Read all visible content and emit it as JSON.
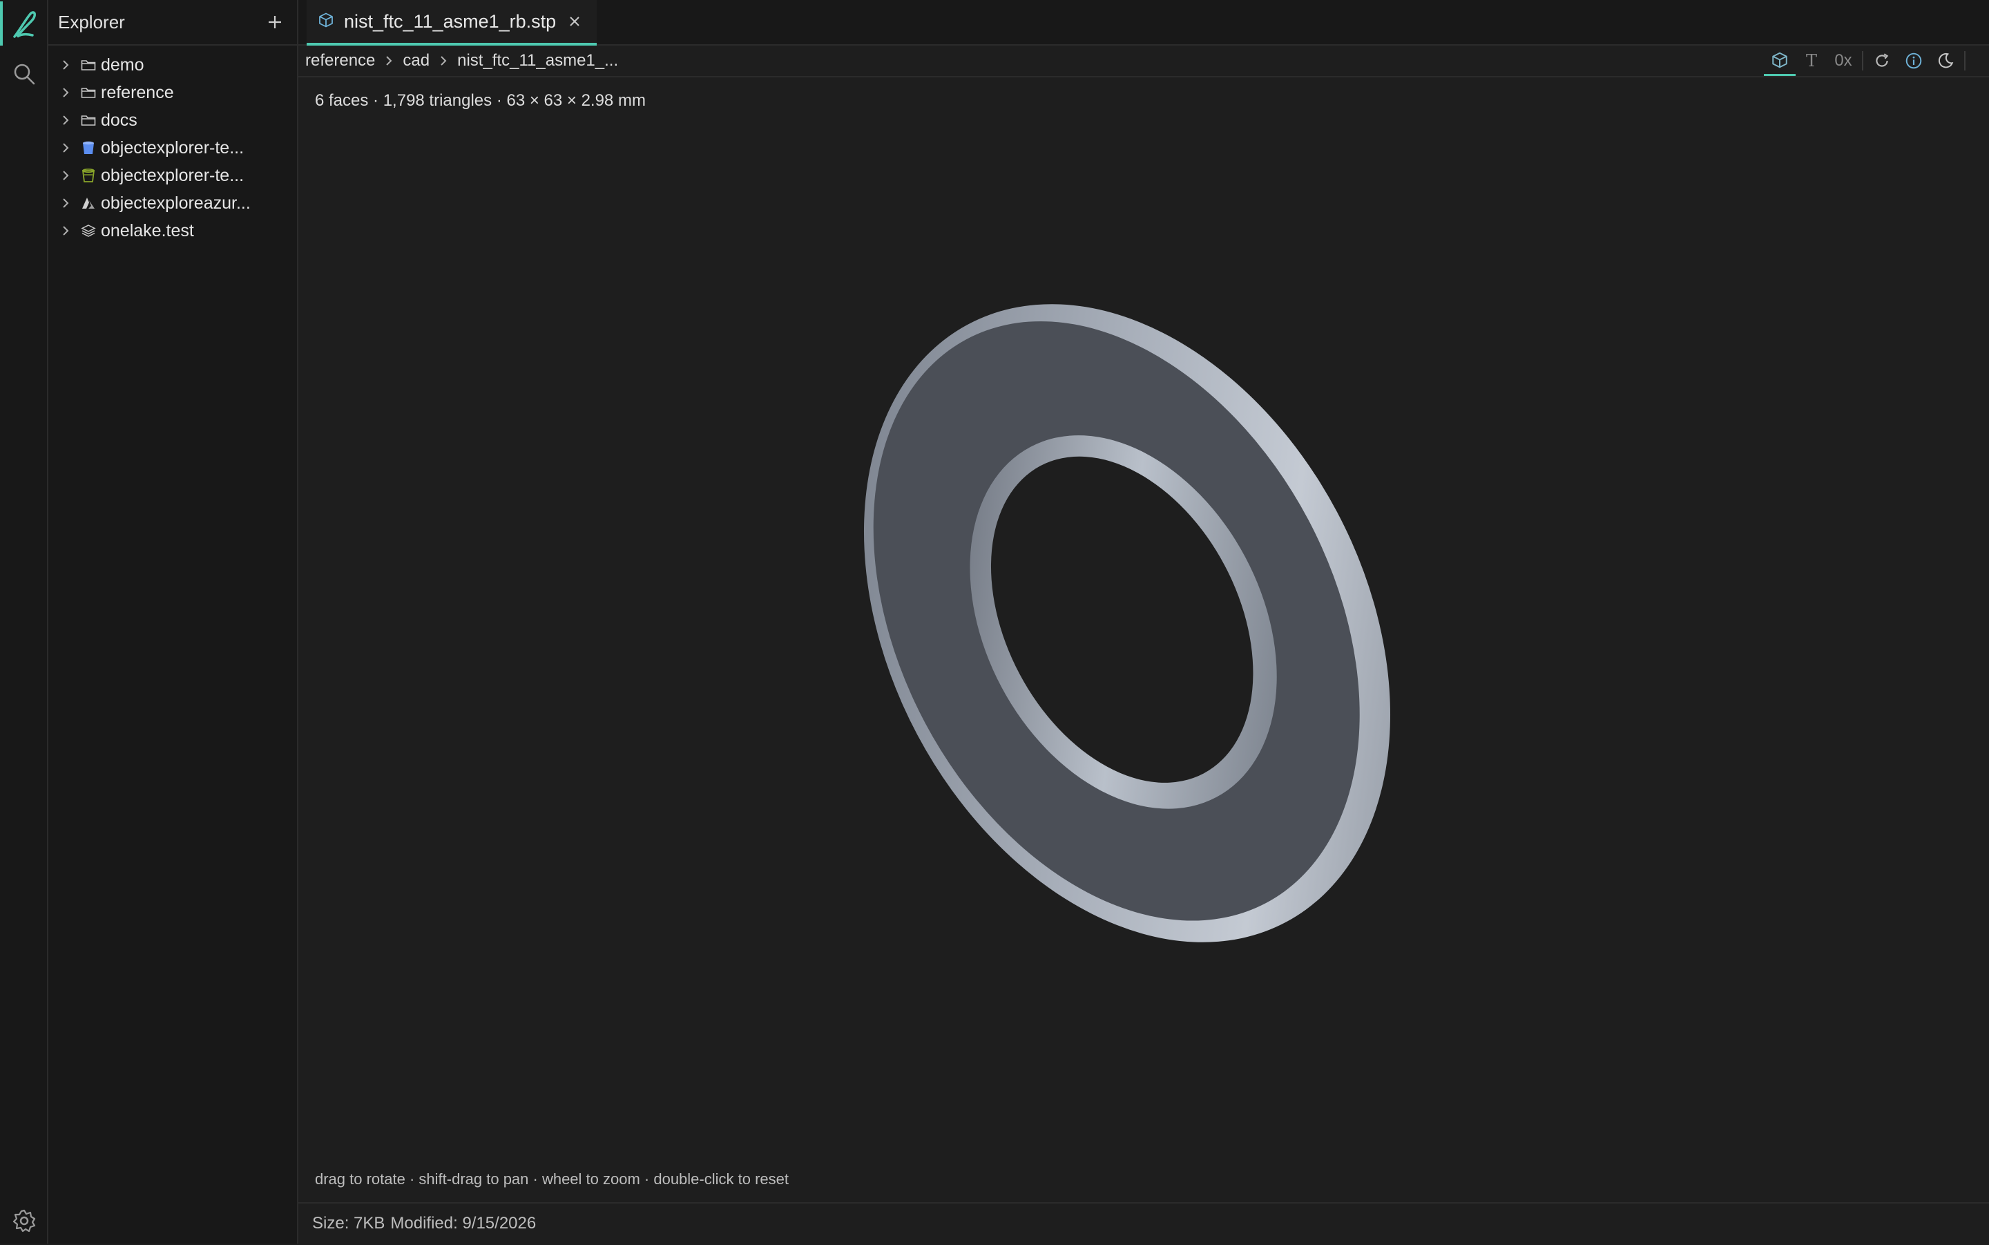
{
  "sidebar": {
    "title": "Explorer",
    "items": [
      {
        "label": "demo",
        "icon": "folder-icon"
      },
      {
        "label": "reference",
        "icon": "folder-icon"
      },
      {
        "label": "docs",
        "icon": "folder-icon"
      },
      {
        "label": "objectexplorer-te...",
        "icon": "bucket-blue-icon"
      },
      {
        "label": "objectexplorer-te...",
        "icon": "bucket-green-icon"
      },
      {
        "label": "objectexploreazur...",
        "icon": "azure-icon"
      },
      {
        "label": "onelake.test",
        "icon": "layers-icon"
      }
    ]
  },
  "tab": {
    "label": "nist_ftc_11_asme1_rb.stp",
    "icon": "cube-icon"
  },
  "breadcrumb": [
    "reference",
    "cad",
    "nist_ftc_11_asme1_..."
  ],
  "toolbar": {
    "text_tool": "T",
    "hex_tool": "0x"
  },
  "viewer": {
    "stats": "6 faces · 1,798 triangles · 63 × 63 × 2.98 mm",
    "hint": "drag to rotate · shift-drag to pan · wheel to zoom · double-click to reset"
  },
  "status": {
    "size": "Size: 7KB",
    "modified": "Modified: 9/15/2026"
  },
  "colors": {
    "accent": "#4ec9b0",
    "background": "#1e1e1e",
    "panel": "#181818",
    "model": "#8a919c"
  }
}
